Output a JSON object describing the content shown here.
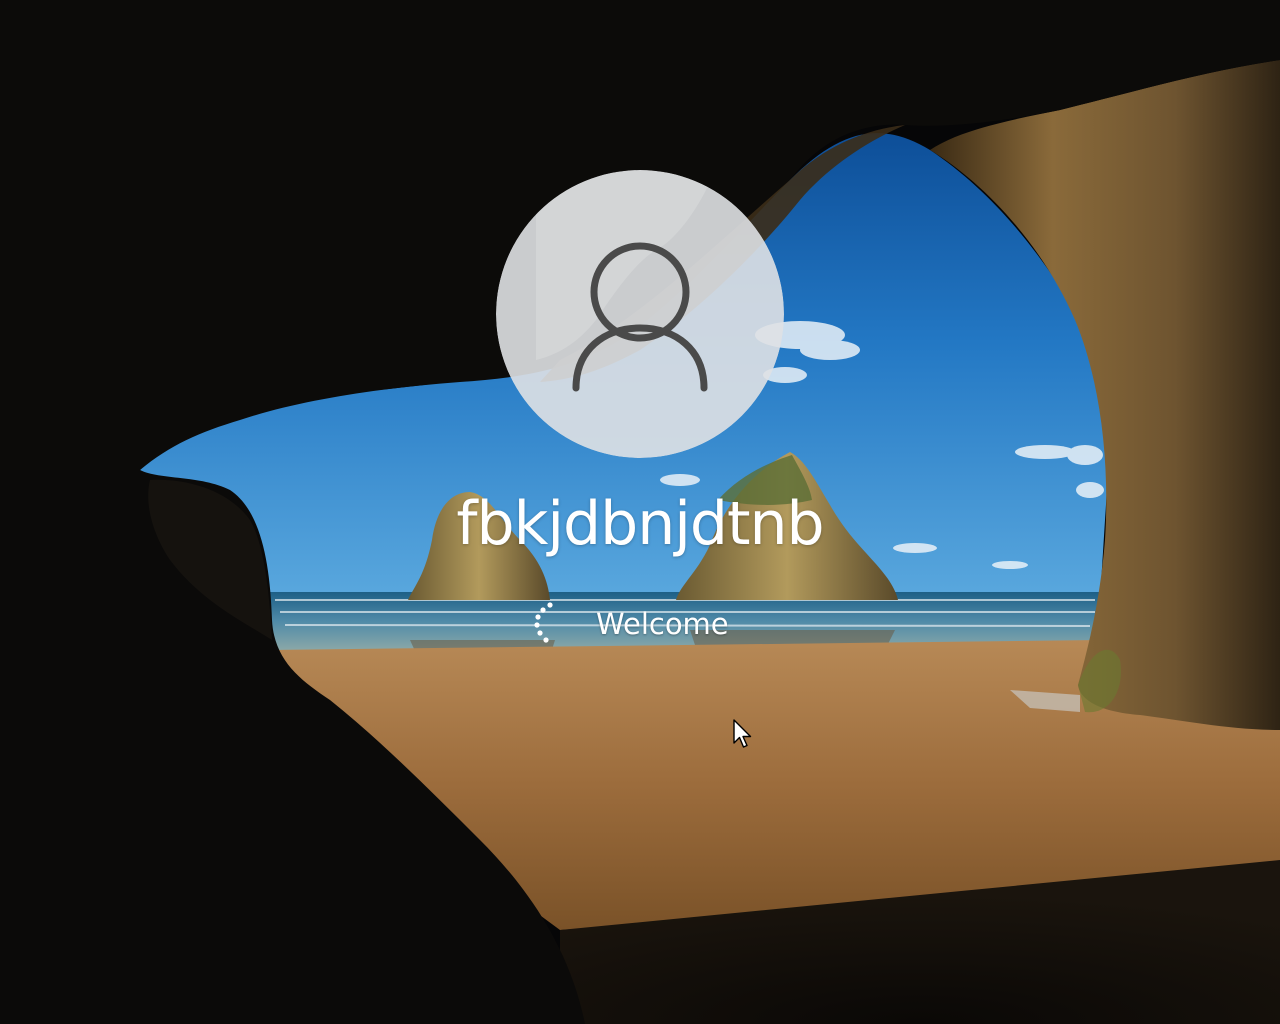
{
  "screen": {
    "type": "Windows sign-in screen",
    "background": "cave-beach"
  },
  "user": {
    "name": "fbkjdbnjdtnb",
    "avatar_icon": "user-silhouette-icon"
  },
  "status": {
    "text": "Welcome",
    "indicator": "loading-spinner-icon"
  },
  "colors": {
    "text": "#ffffff",
    "avatar_fill": "#dfe1e4",
    "avatar_glyph": "#4a4a4a"
  }
}
